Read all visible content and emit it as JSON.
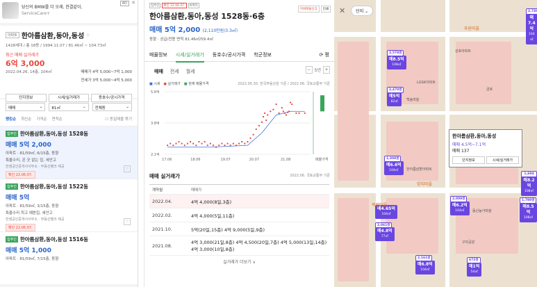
{
  "ad": {
    "line1": "당신의 BMW를 더 오래, 한결같이,",
    "line2": "ServiceCare+",
    "tag": "AD",
    "close": "✕"
  },
  "complex": {
    "tag": "아파트",
    "name": "한아름삼환,동아,동성",
    "meta": "1428세대 / 총 18동 / 1994.11.07 / 81.46㎡ ~ 104.73㎡",
    "recent_label": "최근 매매 실거래가",
    "recent_price": "6억 3,000",
    "recent_date": "2022.04.26, 14층, 104㎡",
    "side1": "매매가 4억 5,000~7억 1,000",
    "side2": "전세가 3억 5,000~4억 5,000",
    "buttons": [
      "단지정보",
      "시세/실거래가",
      "동호수/공시가격"
    ]
  },
  "filters": {
    "sel1": "매매",
    "sel2": "81㎡",
    "sel3": "전체동",
    "sort": [
      "랭킹순",
      "최신순",
      "가격순",
      "면적순"
    ],
    "check": "동일매물 묶기"
  },
  "listings": [
    {
      "tag": "집주인",
      "name": "한아름삼환,동아,동성 1528동",
      "price": "매매 5억 2,000",
      "l1": "아파트 · 81/59㎡, 6/15층, 동향",
      "l2": "특올수리, 온 곳 없는 집, 세안고",
      "agent": "한샘공인중개사사무소 · 부동산뱅크 제공",
      "confirm": "확인 22.06.07."
    },
    {
      "tag": "집주인",
      "name": "한아름삼환,동아,동성 1522동",
      "price": "매매 5억",
      "l1": "아파트 · 81/59㎡, 3/15층, 동향",
      "l2": "특올수리 최고 예쁜집, 세안고",
      "agent": "한샘공인중개사사무소 · 부동산뱅크 제공",
      "confirm": "확인 22.06.07."
    },
    {
      "tag": "집주인",
      "name": "한아름삼환,동아,동성 1516동",
      "price": "매매 5억 1,000",
      "l1": "아파트 · 81/59㎡, 7/15층, 동향",
      "l2": "",
      "agent": "",
      "confirm": ""
    }
  ],
  "detail": {
    "tags": [
      "집주인",
      "확인 22.06.07.",
      "아파트"
    ],
    "btn1": "허위매물신고",
    "btn2": "인쇄",
    "title": "한아름삼환,동아,동성 1528동·6층",
    "price": "매매 5억 2,000",
    "unit": "(2,110만원/3.3㎡)",
    "area": "동향 · 공급/전용 면적 81.46㎡/59.4㎡",
    "tabs": [
      "매물정보",
      "시세/실거래가",
      "동호수/공시가격",
      "학군정보"
    ],
    "tab_icon": "평",
    "subtabs": [
      "매매",
      "전세",
      "월세"
    ],
    "period": "5년",
    "legend": [
      "시세",
      "실거래가",
      "현재 매물가격"
    ],
    "legend_src": "2022.05.30. 한국부동산원 기준 / 2022.06. 국토교통부 기준",
    "sec": "매매 실거래가",
    "sec_src": "2022.06. 국토교통부 기준",
    "col1": "계약월",
    "col2": "매매가",
    "rows": [
      {
        "m": "2022.04.",
        "v": "4억 4,000(8일,3층)"
      },
      {
        "m": "2022.02.",
        "v": "4억 4,000(5일,11층)"
      },
      {
        "m": "2021.10.",
        "v": "5억(20일,15층)      4억 9,000(5일,9층)"
      },
      {
        "m": "2021.08.",
        "v": "4억 3,000(21일,8층)    4억 4,500(20일,7층)   4억 5,000(13일,14층)   4억 3,000(10일,8층)"
      }
    ],
    "more": "실거래가 더보기 ∨"
  },
  "chart_data": {
    "type": "scatter",
    "title": "",
    "xlabel": "",
    "ylabel": "",
    "x_ticks": [
      "17.06",
      "18.06",
      "19.07",
      "20.07",
      "21.08",
      "매물가격"
    ],
    "y_ticks": [
      "5.6억",
      "3.8억",
      "2.1억"
    ],
    "ylim": [
      2.1,
      5.6
    ],
    "series": [
      {
        "name": "실거래가",
        "points": [
          [
            2017.5,
            2.6
          ],
          [
            2017.6,
            2.7
          ],
          [
            2017.7,
            2.6
          ],
          [
            2017.8,
            2.7
          ],
          [
            2017.9,
            2.8
          ],
          [
            2018.0,
            2.7
          ],
          [
            2018.1,
            2.6
          ],
          [
            2018.2,
            2.7
          ],
          [
            2018.3,
            2.8
          ],
          [
            2018.4,
            2.7
          ],
          [
            2018.5,
            2.6
          ],
          [
            2018.6,
            2.8
          ],
          [
            2018.7,
            2.7
          ],
          [
            2018.8,
            2.8
          ],
          [
            2018.9,
            2.6
          ],
          [
            2019.0,
            2.7
          ],
          [
            2019.1,
            2.6
          ],
          [
            2019.2,
            2.5
          ],
          [
            2019.3,
            2.6
          ],
          [
            2019.4,
            2.7
          ],
          [
            2019.5,
            2.6
          ],
          [
            2019.6,
            2.7
          ],
          [
            2019.7,
            2.6
          ],
          [
            2019.8,
            2.7
          ],
          [
            2019.9,
            2.6
          ],
          [
            2020.0,
            2.7
          ],
          [
            2020.1,
            2.8
          ],
          [
            2020.2,
            2.7
          ],
          [
            2020.3,
            2.8
          ],
          [
            2020.4,
            3.0
          ],
          [
            2020.5,
            3.2
          ],
          [
            2020.6,
            3.5
          ],
          [
            2020.7,
            3.7
          ],
          [
            2020.8,
            3.9
          ],
          [
            2020.85,
            4.2
          ],
          [
            2020.9,
            4.4
          ],
          [
            2020.95,
            4.0
          ],
          [
            2021.0,
            4.3
          ],
          [
            2021.1,
            4.5
          ],
          [
            2021.2,
            4.6
          ],
          [
            2021.3,
            4.9
          ],
          [
            2021.4,
            4.4
          ],
          [
            2021.5,
            4.7
          ],
          [
            2021.55,
            4.5
          ],
          [
            2021.6,
            4.4
          ],
          [
            2021.65,
            4.3
          ],
          [
            2021.7,
            4.45
          ],
          [
            2021.75,
            4.5
          ],
          [
            2021.8,
            5.0
          ],
          [
            2021.85,
            4.9
          ],
          [
            2022.0,
            4.4
          ],
          [
            2022.1,
            4.4
          ],
          [
            2022.3,
            4.4
          ]
        ]
      },
      {
        "name": "시세",
        "points": [
          [
            2017.5,
            2.5
          ],
          [
            2019.0,
            2.5
          ],
          [
            2020.3,
            2.6
          ],
          [
            2020.8,
            3.3
          ],
          [
            2021.3,
            4.3
          ],
          [
            2021.8,
            4.5
          ],
          [
            2022.3,
            4.5
          ]
        ]
      }
    ],
    "current_listing": {
      "low": 4.5,
      "high": 5.4
    }
  },
  "map": {
    "filter": "단지",
    "close": "✕",
    "pins": [
      {
        "p": "매7.4억",
        "s": "104㎡"
      },
      {
        "p": "매8.5억",
        "s": "108㎡"
      },
      {
        "p": "매5억",
        "s": "82㎡"
      },
      {
        "p": "매6.6억",
        "s": "104㎡"
      },
      {
        "p": "매4.65억",
        "s": "104㎡"
      },
      {
        "p": "매4.8억",
        "s": "77㎡"
      },
      {
        "p": "매6.2억",
        "s": "104㎡"
      },
      {
        "p": "매6.8억",
        "s": "104㎡"
      },
      {
        "p": "매1억",
        "s": "54㎡"
      },
      {
        "p": "매8.2억",
        "s": "108㎡"
      },
      {
        "p": "매8.5억",
        "s": "108㎡"
      }
    ],
    "counts": [
      "2,749쌍",
      "2,578쌍",
      "2,470쌍",
      "1,308쌍",
      "2,009쌍",
      "2,061쌍",
      "2,161쌍",
      "672쌍",
      "1,694쌍",
      "1,780쌍"
    ],
    "labels": [
      "푸른마을",
      "LGSK아파트",
      "백송마을",
      "성호아파트",
      "목련마을",
      "한아름삼환아파트",
      "양지마을",
      "금호",
      "동산농가마을",
      "구미공원"
    ],
    "popup": {
      "name": "한아름삼환,동아,동성",
      "price": "매매 4.5억~7.1억",
      "count": "매매 137",
      "b1": "단지정보",
      "b2": "시세/실거래가"
    }
  }
}
